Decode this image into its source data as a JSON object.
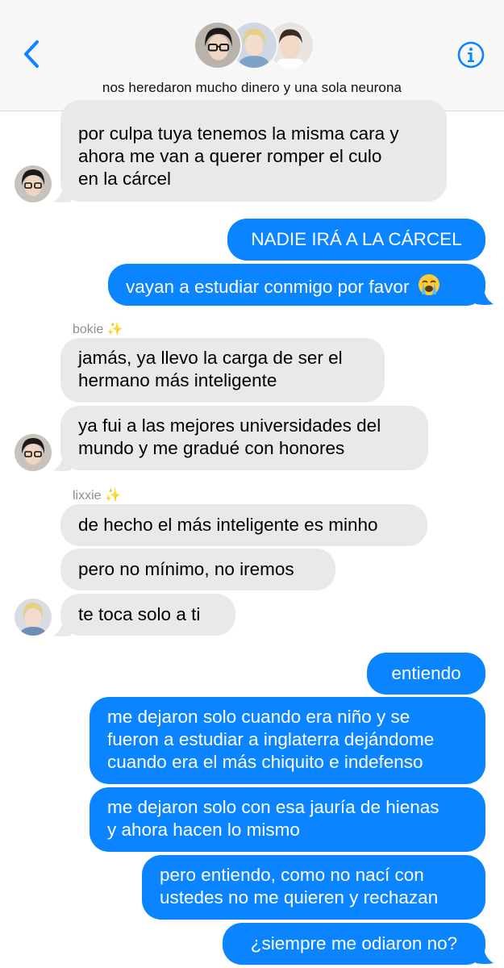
{
  "header": {
    "back_icon": "chevron-left-icon",
    "info_icon": "info-circle-icon",
    "group_name": "nos heredaron mucho dinero y una sola neurona",
    "accent": "#0a84ff"
  },
  "messages": [
    {
      "type": "received",
      "lines": [
        "por culpa tuya tenemos la misma cara y",
        "ahora me van a querer romper el culo",
        "en la cárcel"
      ]
    },
    {
      "type": "sent",
      "lines": [
        "NADIE IRÁ A LA CÁRCEL"
      ]
    },
    {
      "type": "sent",
      "lines": [
        "vayan a estudiar conmigo por favor"
      ],
      "emoji": "loudly-crying-face-emoji"
    },
    {
      "type": "sender",
      "name": "bokie",
      "sparkles": "✨"
    },
    {
      "type": "received",
      "lines": [
        "jamás, ya llevo la carga de ser el",
        "hermano más inteligente"
      ]
    },
    {
      "type": "received",
      "lines": [
        "ya fui a las mejores universidades del",
        "mundo y me gradué con honores"
      ]
    },
    {
      "type": "sender",
      "name": "lixxie",
      "sparkles": "✨"
    },
    {
      "type": "received",
      "lines": [
        "de hecho el más inteligente es minho"
      ]
    },
    {
      "type": "received",
      "lines": [
        "pero no mínimo, no iremos"
      ]
    },
    {
      "type": "received",
      "lines": [
        "te toca solo a ti"
      ]
    },
    {
      "type": "sent",
      "lines": [
        "entiendo"
      ]
    },
    {
      "type": "sent",
      "lines": [
        "me dejaron solo cuando era niño y se",
        "fueron a estudiar a inglaterra dejándome",
        "cuando era el más chiquito e indefenso"
      ]
    },
    {
      "type": "sent",
      "lines": [
        "me dejaron solo con esa jauría de hienas",
        "y ahora hacen lo mismo"
      ]
    },
    {
      "type": "sent",
      "lines": [
        "pero entiendo, como no nací con",
        "ustedes no me quieren y rechazan"
      ]
    },
    {
      "type": "sent",
      "lines": [
        "¿siempre me odiaron no?"
      ]
    }
  ]
}
